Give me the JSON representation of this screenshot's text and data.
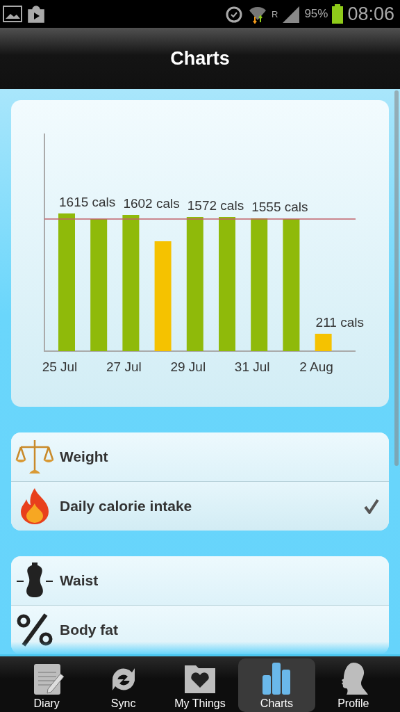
{
  "status_bar": {
    "roaming": "R",
    "battery": "95%",
    "time": "08:06"
  },
  "header": {
    "title": "Charts"
  },
  "chart": {
    "bars": [
      {
        "color": "#8fba0a",
        "label": "1615 cals",
        "date": "25 Jul"
      },
      {
        "color": "#8fba0a"
      },
      {
        "color": "#8fba0a",
        "label": "1602 cals",
        "date": "27 Jul"
      },
      {
        "color": "#f5c200"
      },
      {
        "color": "#8fba0a",
        "label": "1572 cals",
        "date": "29 Jul"
      },
      {
        "color": "#8fba0a"
      },
      {
        "color": "#8fba0a",
        "label": "1555 cals",
        "date": "31 Jul"
      },
      {
        "color": "#8fba0a"
      },
      {
        "color": "#f5c200",
        "label": "211 cals",
        "date": "2 Aug"
      }
    ]
  },
  "groups": [
    {
      "items": [
        {
          "label": "Weight",
          "kind": "scales",
          "selected": false
        },
        {
          "label": "Daily calorie intake",
          "kind": "flame",
          "selected": true
        }
      ]
    },
    {
      "items": [
        {
          "label": "Waist",
          "kind": "torso",
          "selected": false
        },
        {
          "label": "Body fat",
          "kind": "percent",
          "selected": false
        }
      ]
    }
  ],
  "tabs": [
    {
      "label": "Diary",
      "kind": "notepad",
      "selected": false
    },
    {
      "label": "Sync",
      "kind": "sync",
      "selected": false
    },
    {
      "label": "My Things",
      "kind": "folder",
      "selected": false
    },
    {
      "label": "Charts",
      "kind": "bars",
      "selected": true
    },
    {
      "label": "Profile",
      "kind": "head",
      "selected": false
    }
  ]
}
